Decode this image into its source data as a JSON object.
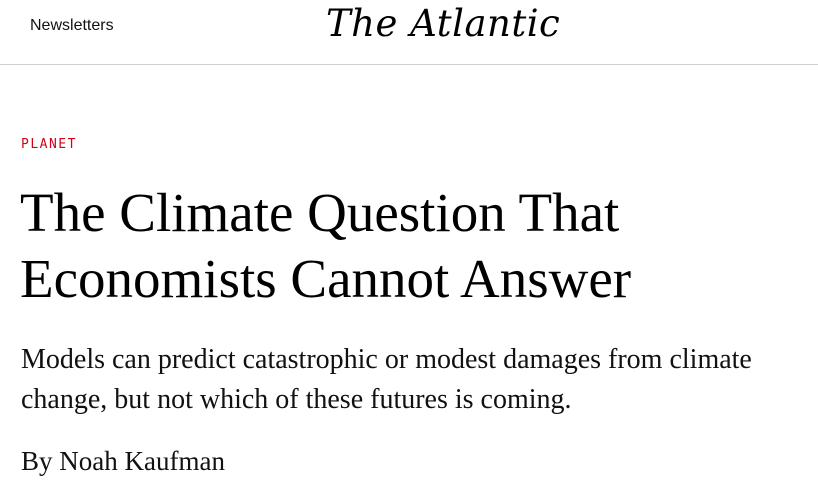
{
  "header": {
    "nav_link": "Newsletters",
    "logo": "The Atlantic"
  },
  "article": {
    "section": "PLANET",
    "title_line1": "The Climate Question That",
    "title_line2": "Economists Cannot Answer",
    "dek": "Models can predict catastrophic or modest damages from climate change, but not which of these futures is coming.",
    "byline_prefix": "By",
    "author": "Noah Kaufman"
  },
  "colors": {
    "section_accent": "#d0021b",
    "divider": "#cfcfcf"
  }
}
